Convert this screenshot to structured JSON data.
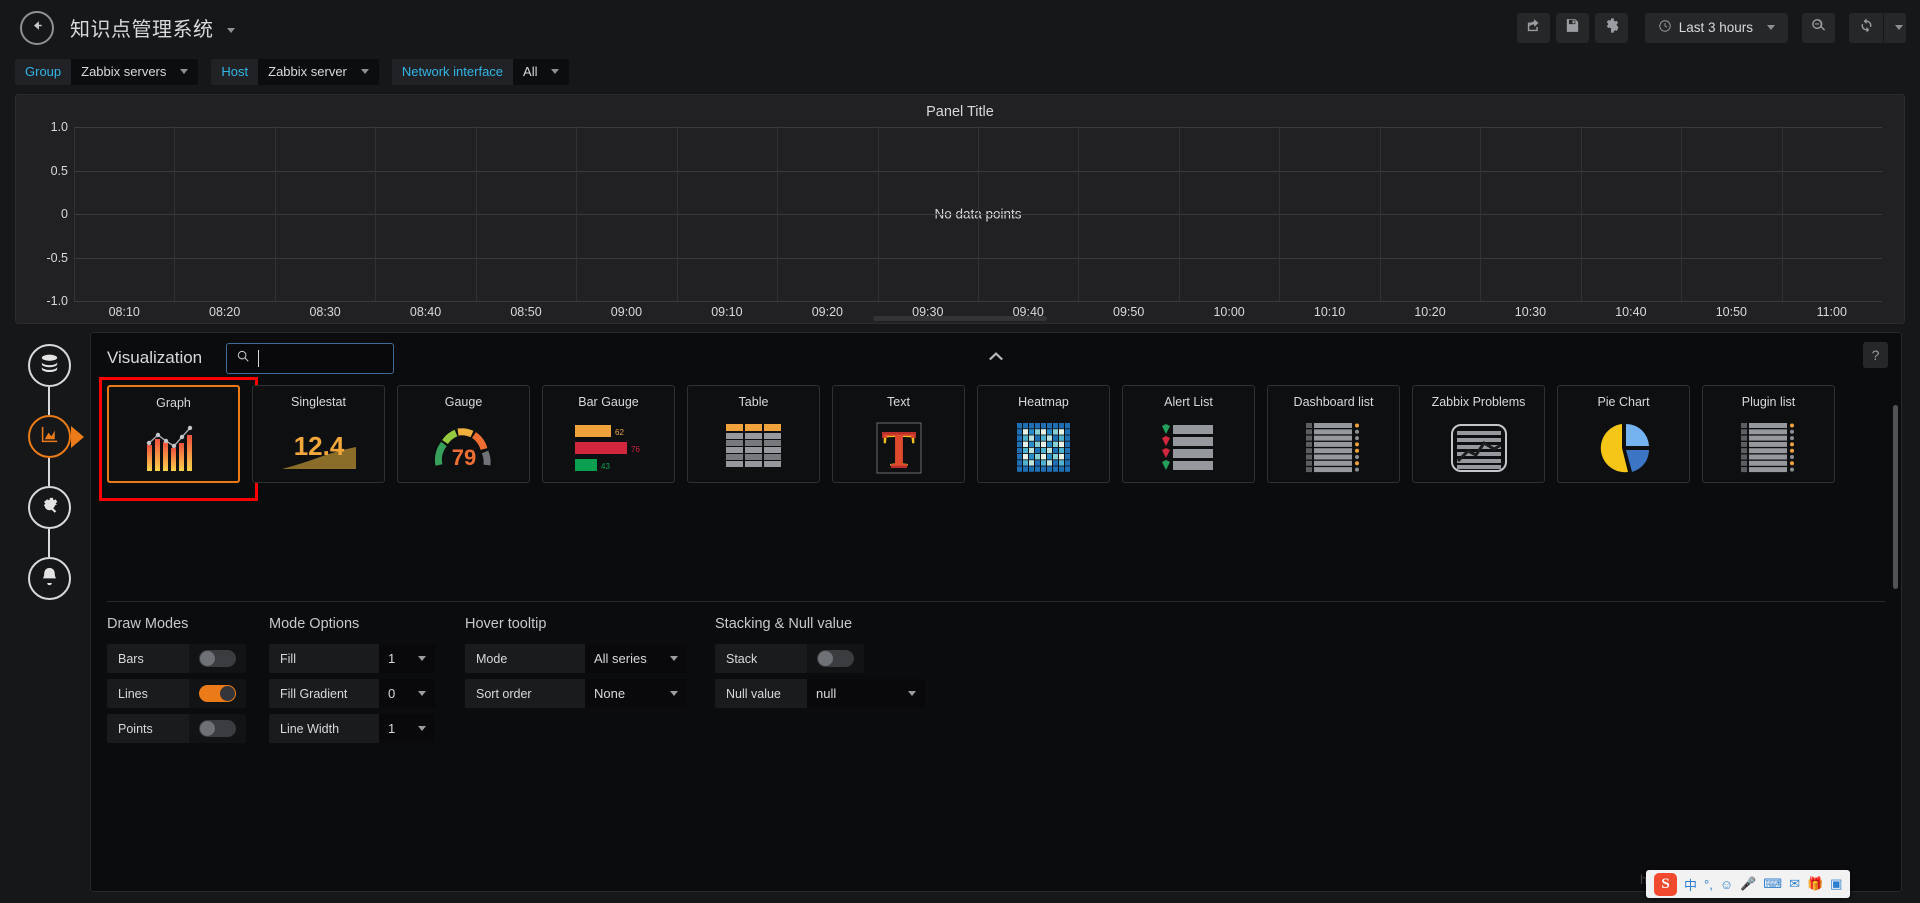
{
  "navbar": {
    "back_icon": "arrow-left-circle-icon",
    "dashboard_title": "知识点管理系统",
    "actions": [
      {
        "name": "share-dashboard",
        "icon": "share-icon"
      },
      {
        "name": "save-dashboard",
        "icon": "floppy-save-icon"
      },
      {
        "name": "dashboard-settings",
        "icon": "gear-icon"
      }
    ],
    "time_range": "Last 3 hours",
    "time_icon": "clock-icon",
    "zoom_out_icon": "magnifier-minus-icon",
    "refresh_icon": "refresh-icon",
    "refresh_dropdown_icon": "chevron-down-icon"
  },
  "variables": [
    {
      "label": "Group",
      "value": "Zabbix servers"
    },
    {
      "label": "Host",
      "value": "Zabbix server"
    },
    {
      "label": "Network interface",
      "value": "All"
    }
  ],
  "panel": {
    "title": "Panel Title",
    "empty_message": "No data points"
  },
  "chart_data": {
    "type": "line",
    "title": "Panel Title",
    "xlabel": "",
    "ylabel": "",
    "series": [],
    "x_ticks": [
      "08:10",
      "08:20",
      "08:30",
      "08:40",
      "08:50",
      "09:00",
      "09:10",
      "09:20",
      "09:30",
      "09:40",
      "09:50",
      "10:00",
      "10:10",
      "10:20",
      "10:30",
      "10:40",
      "10:50",
      "11:00"
    ],
    "y_ticks": [
      "1.0",
      "0.5",
      "0",
      "-0.5",
      "-1.0"
    ],
    "ylim": [
      -1.0,
      1.0
    ],
    "grid": true,
    "legend": "none",
    "empty": true,
    "empty_message": "No data points"
  },
  "editor": {
    "rail": [
      {
        "name": "queries-tab",
        "icon": "database-icon",
        "active": false
      },
      {
        "name": "visualization-tab",
        "icon": "area-chart-icon",
        "active": true
      },
      {
        "name": "general-tab",
        "icon": "gear-wrench-icon",
        "active": false
      },
      {
        "name": "alert-tab",
        "icon": "bell-icon",
        "active": false
      }
    ],
    "section_title": "Visualization",
    "search": {
      "value": "",
      "placeholder": "",
      "icon": "search-icon"
    },
    "collapse_icon": "chevron-up-icon",
    "help_label": "?",
    "panel_types": [
      {
        "name": "Graph",
        "art": "graph",
        "selected": true
      },
      {
        "name": "Singlestat",
        "art": "singlestat",
        "value": "12.4"
      },
      {
        "name": "Gauge",
        "art": "gauge",
        "value": "79"
      },
      {
        "name": "Bar Gauge",
        "art": "bargauge",
        "values": [
          "62",
          "76",
          "43"
        ]
      },
      {
        "name": "Table",
        "art": "table"
      },
      {
        "name": "Text",
        "art": "text",
        "value": "T"
      },
      {
        "name": "Heatmap",
        "art": "heatmap"
      },
      {
        "name": "Alert List",
        "art": "alertlist"
      },
      {
        "name": "Dashboard list",
        "art": "dashlist"
      },
      {
        "name": "Zabbix Problems",
        "art": "zabbix"
      },
      {
        "name": "Pie Chart",
        "art": "piechart"
      },
      {
        "name": "Plugin list",
        "art": "pluginlist"
      }
    ],
    "options": {
      "draw_modes": {
        "title": "Draw Modes",
        "rows": [
          {
            "label": "Bars",
            "on": false
          },
          {
            "label": "Lines",
            "on": true
          },
          {
            "label": "Points",
            "on": false
          }
        ]
      },
      "mode_options": {
        "title": "Mode Options",
        "rows": [
          {
            "label": "Fill",
            "value": "1"
          },
          {
            "label": "Fill Gradient",
            "value": "0"
          },
          {
            "label": "Line Width",
            "value": "1"
          }
        ]
      },
      "hover_tooltip": {
        "title": "Hover tooltip",
        "rows": [
          {
            "label": "Mode",
            "value": "All series"
          },
          {
            "label": "Sort order",
            "value": "None"
          }
        ]
      },
      "stacking": {
        "title": "Stacking & Null value",
        "rows": [
          {
            "label": "Stack",
            "toggle": true,
            "on": false
          },
          {
            "label": "Null value",
            "value": "null"
          }
        ]
      }
    }
  },
  "ime": {
    "logo": "S",
    "items": [
      "中",
      "°,",
      "☺",
      "🎤",
      "⌨",
      "✉",
      "🎁",
      "▣"
    ],
    "ghost_url": "https://..."
  },
  "colors": {
    "accent_orange": "#eb7b18",
    "link_cyan": "#33b5e5",
    "panel_bg": "#212124",
    "page_bg": "#161719",
    "highlight_red": "#ff0000"
  }
}
